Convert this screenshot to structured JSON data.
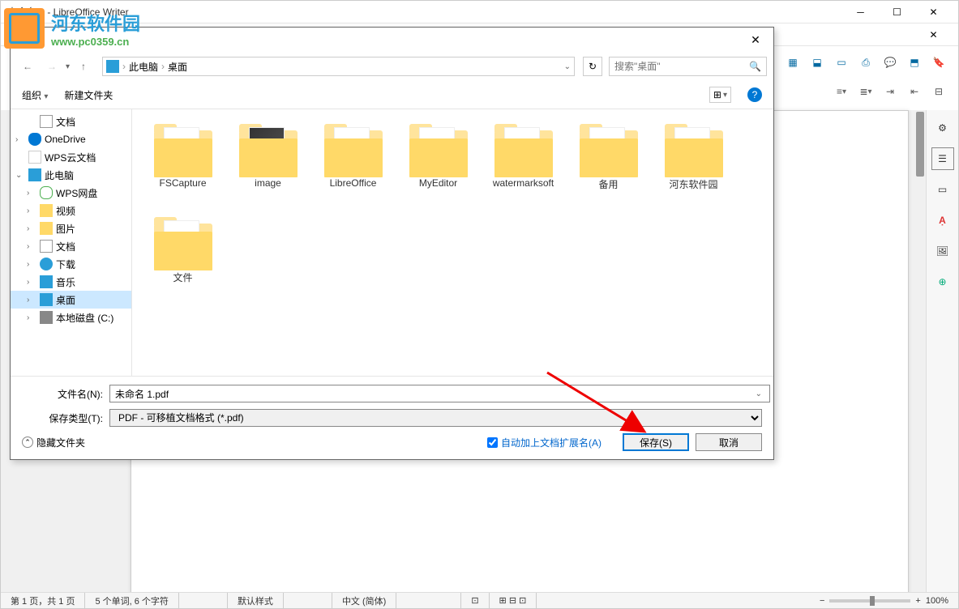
{
  "window": {
    "title": "未命名 1 - LibreOffice Writer"
  },
  "watermark": {
    "site_name": "河东软件园",
    "url": "www.pc0359.cn"
  },
  "dialog": {
    "nav": {
      "breadcrumb_root": "此电脑",
      "breadcrumb_current": "桌面",
      "search_placeholder": "搜索\"桌面\""
    },
    "toolbar": {
      "organize": "组织",
      "new_folder": "新建文件夹"
    },
    "tree": [
      {
        "label": "文档",
        "icon": "doc",
        "indent": 1
      },
      {
        "label": "OneDrive",
        "icon": "onedrive",
        "indent": 0,
        "expand": "›"
      },
      {
        "label": "WPS云文档",
        "icon": "wps",
        "indent": 0
      },
      {
        "label": "此电脑",
        "icon": "pc",
        "indent": 0,
        "expand": "⌄"
      },
      {
        "label": "WPS网盘",
        "icon": "cloud",
        "indent": 1,
        "expand": "›"
      },
      {
        "label": "视频",
        "icon": "folder-s",
        "indent": 1,
        "expand": "›"
      },
      {
        "label": "图片",
        "icon": "folder-s",
        "indent": 1,
        "expand": "›"
      },
      {
        "label": "文档",
        "icon": "doc",
        "indent": 1,
        "expand": "›"
      },
      {
        "label": "下载",
        "icon": "down",
        "indent": 1,
        "expand": "›"
      },
      {
        "label": "音乐",
        "icon": "music",
        "indent": 1,
        "expand": "›"
      },
      {
        "label": "桌面",
        "icon": "pc",
        "indent": 1,
        "expand": "›",
        "selected": true
      },
      {
        "label": "本地磁盘 (C:)",
        "icon": "disk",
        "indent": 1,
        "expand": "›"
      }
    ],
    "files": [
      {
        "name": "FSCapture",
        "thumb": "gear"
      },
      {
        "name": "image",
        "thumb": "img"
      },
      {
        "name": "LibreOffice",
        "thumb": "app"
      },
      {
        "name": "MyEditor",
        "thumb": "app"
      },
      {
        "name": "watermarksoft",
        "thumb": "paper"
      },
      {
        "name": "备用",
        "thumb": "paper"
      },
      {
        "name": "河东软件园",
        "thumb": "paper"
      },
      {
        "name": "文件",
        "thumb": "doc"
      }
    ],
    "filename_label": "文件名(N):",
    "filename_value": "未命名 1.pdf",
    "filetype_label": "保存类型(T):",
    "filetype_value": "PDF - 可移植文档格式 (*.pdf)",
    "hide_folders": "隐藏文件夹",
    "auto_ext": "自动加上文档扩展名(A)",
    "save_btn": "保存(S)",
    "cancel_btn": "取消"
  },
  "statusbar": {
    "page_info": "第 1 页，共 1 页",
    "word_count": "5 个单词, 6 个字符",
    "style": "默认样式",
    "language": "中文 (简体)",
    "zoom": "100%"
  }
}
